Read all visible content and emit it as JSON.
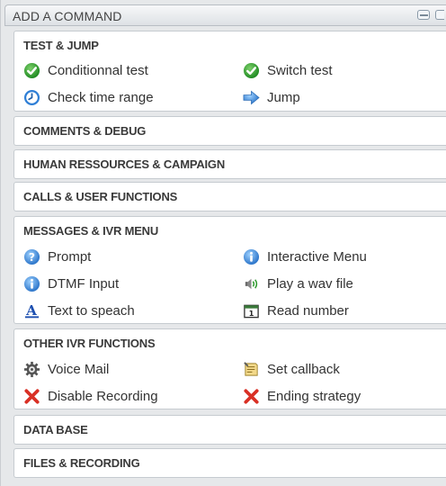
{
  "window": {
    "title": "ADD A COMMAND"
  },
  "sections": {
    "test_jump": {
      "title": "TEST & JUMP",
      "items": {
        "conditional_test": {
          "label": "Conditionnal test",
          "icon": "green-check-icon"
        },
        "switch_test": {
          "label": "Switch test",
          "icon": "green-check-icon"
        },
        "check_time_range": {
          "label": "Check time range",
          "icon": "clock-icon"
        },
        "jump": {
          "label": "Jump",
          "icon": "blue-arrow-right-icon"
        }
      }
    },
    "comments_debug": {
      "title": "COMMENTS & DEBUG"
    },
    "human_resources": {
      "title": "HUMAN RESSOURCES & CAMPAIGN"
    },
    "calls_user_functions": {
      "title": "CALLS & USER FUNCTIONS"
    },
    "messages_ivr": {
      "title": "MESSAGES & IVR MENU",
      "items": {
        "prompt": {
          "label": "Prompt",
          "icon": "question-icon"
        },
        "interactive_menu": {
          "label": "Interactive Menu",
          "icon": "info-icon"
        },
        "dtmf_input": {
          "label": "DTMF Input",
          "icon": "info-icon"
        },
        "play_wav": {
          "label": "Play a wav file",
          "icon": "speaker-icon"
        },
        "text_to_speech": {
          "label": "Text to speach",
          "icon": "text-a-icon"
        },
        "read_number": {
          "label": "Read number",
          "icon": "calendar-icon"
        }
      }
    },
    "other_ivr": {
      "title": "OTHER IVR FUNCTIONS",
      "items": {
        "voice_mail": {
          "label": "Voice Mail",
          "icon": "gear-icon"
        },
        "set_callback": {
          "label": "Set callback",
          "icon": "note-icon"
        },
        "disable_recording": {
          "label": "Disable Recording",
          "icon": "red-x-icon"
        },
        "ending_strategy": {
          "label": "Ending strategy",
          "icon": "red-x-icon"
        }
      }
    },
    "data_base": {
      "title": "DATA BASE"
    },
    "files_recording": {
      "title": "FILES & RECORDING"
    }
  },
  "colors": {
    "check_green": "#2e9a2e",
    "info_blue": "#3a8ad8",
    "red_x": "#d93025",
    "section_border": "#c6cbd0"
  }
}
